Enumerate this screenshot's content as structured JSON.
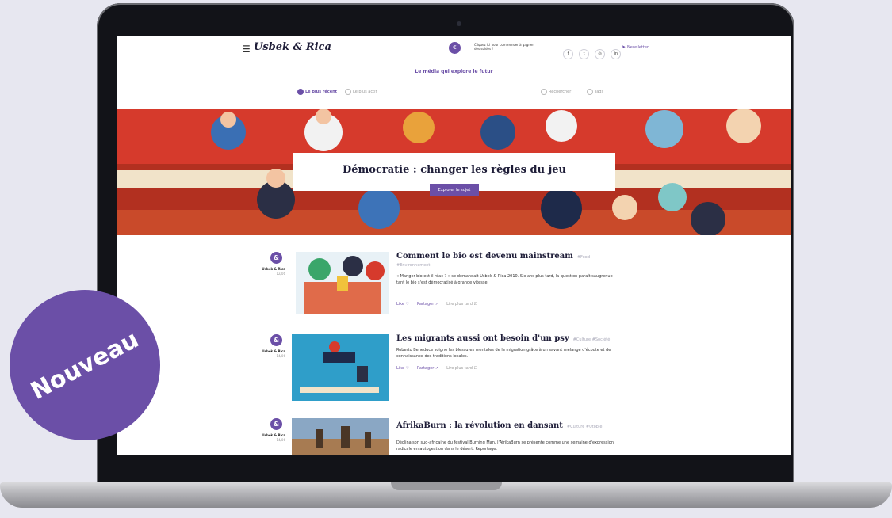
{
  "colors": {
    "accent": "#6b4fa7",
    "background": "#e7e7f0",
    "hero_red": "#d63a2c",
    "ink": "#1e1d38"
  },
  "header": {
    "menu_icon": "hamburger-icon",
    "logo": "Usbek & Rica",
    "promo_button_icon": "euro-coin-icon",
    "promo_text": "Cliquez ici pour commencer à gagner des soldes !",
    "social": [
      {
        "icon": "facebook-icon",
        "glyph": "f"
      },
      {
        "icon": "twitter-icon",
        "glyph": "t"
      },
      {
        "icon": "instagram-icon",
        "glyph": "◎"
      },
      {
        "icon": "linkedin-icon",
        "glyph": "in"
      }
    ],
    "newsletter_label": "Newsletter",
    "newsletter_icon": "paper-plane-icon"
  },
  "tagline": "Le média qui explore le futur",
  "filters": {
    "recent": "Le plus récent",
    "active": "Le plus actif",
    "search": "Rechercher",
    "tags": "Tags"
  },
  "hero": {
    "title": "Démocratie : changer les règles du jeu",
    "button": "Explorer le sujet"
  },
  "articles": [
    {
      "author": "Usbek & Rica",
      "date": "12/06",
      "title": "Comment le bio est devenu mainstream",
      "tags_inline": "#Food",
      "tags_line2": "#Environnement",
      "excerpt": "« Manger bio est-il réac ? » se demandait Usbek & Rica 2010. Six ans plus tard, la question paraît saugrenue tant le bio s'est démocratisé à grande vitesse.",
      "like": "Like ♡",
      "share": "Partager ↗",
      "later": "Lire plus tard ⊡"
    },
    {
      "author": "Usbek & Rica",
      "date": "14/06",
      "title": "Les migrants aussi ont besoin d'un psy",
      "tags_inline": "#Culture #Société",
      "tags_line2": "",
      "excerpt": "Roberto Beneduce soigne les blessures mentales de la migration grâce à un savant mélange d'écoute et de connaissance des traditions locales.",
      "like": "Like ♡",
      "share": "Partager ↗",
      "later": "Lire plus tard ⊡"
    },
    {
      "author": "Usbek & Rica",
      "date": "14/06",
      "title": "AfrikaBurn : la révolution en dansant",
      "tags_inline": "#Culture #Utopie",
      "tags_line2": "",
      "excerpt": "Déclinaison sud-africaine du festival Burning Man, l'AfrikaBurn se présente comme une semaine d'expression radicale en autogestion dans le désert. Reportage.",
      "like": "",
      "share": "",
      "later": ""
    }
  ],
  "badge": "Nouveau"
}
